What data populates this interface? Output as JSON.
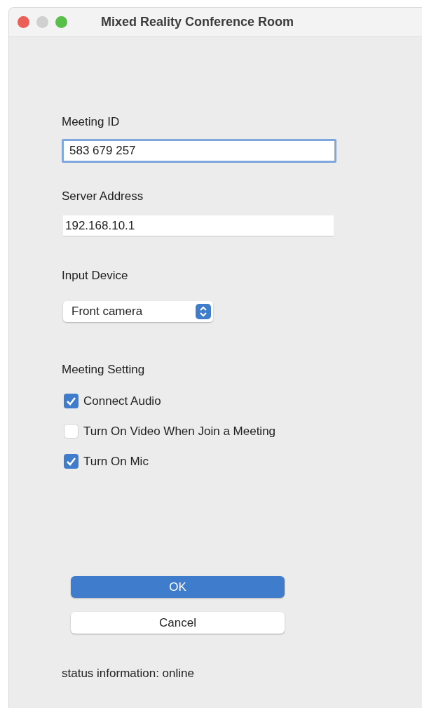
{
  "window": {
    "title": "Mixed Reality Conference Room"
  },
  "fields": [
    {
      "label": "Meeting ID",
      "value": "583 679 257",
      "focused": true
    },
    {
      "label": "Server Address",
      "value": "192.168.10.1",
      "focused": false
    }
  ],
  "input_device": {
    "label": "Input Device",
    "value": "Front camera"
  },
  "meeting_setting": {
    "label": "Meeting Setting",
    "options": [
      {
        "label": "Connect Audio",
        "checked": true
      },
      {
        "label": "Turn On Video When Join a Meeting",
        "checked": false
      },
      {
        "label": "Turn On Mic",
        "checked": true
      }
    ]
  },
  "buttons": [
    {
      "label": "OK",
      "kind": "primary"
    },
    {
      "label": "Cancel",
      "kind": "secondary"
    }
  ],
  "status_bar": "status information: online"
}
